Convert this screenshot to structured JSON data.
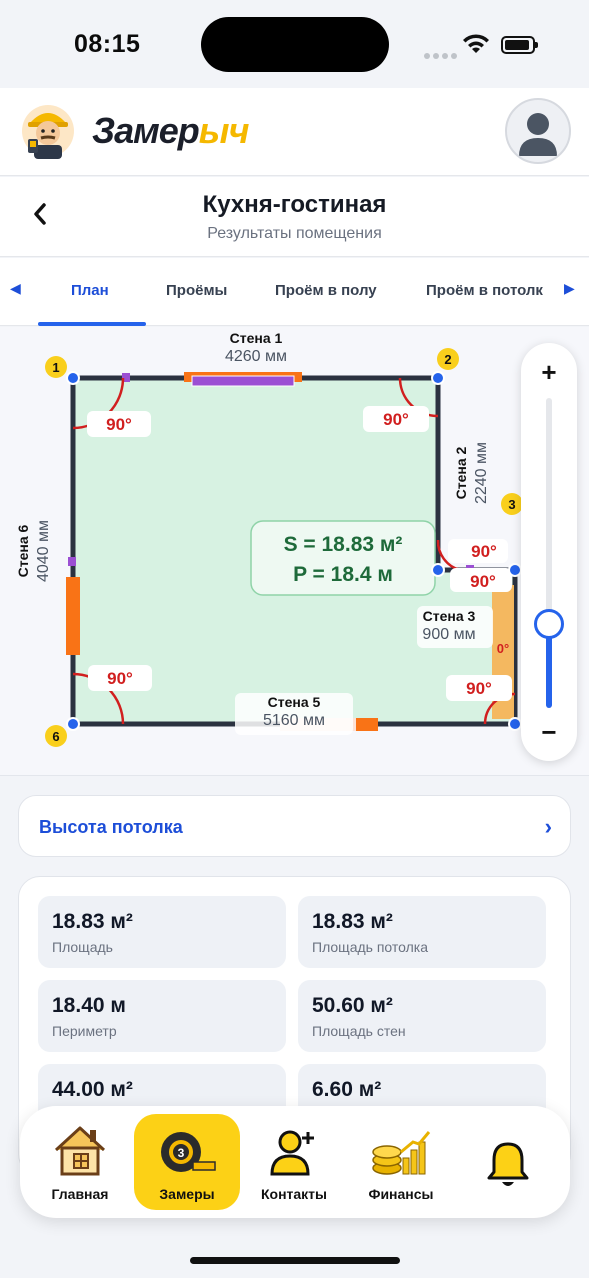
{
  "status_bar": {
    "time": "08:15"
  },
  "header": {
    "brand_part1": "Замер",
    "brand_part2": "ыч"
  },
  "title_bar": {
    "title": "Кухня-гостиная",
    "subtitle": "Результаты помещения"
  },
  "tabs": [
    {
      "label": "План",
      "active": true
    },
    {
      "label": "Проёмы",
      "active": false
    },
    {
      "label": "Проём в полу",
      "active": false
    },
    {
      "label": "Проём в потолк",
      "active": false
    }
  ],
  "plan": {
    "area_text": "S = 18.83 м²",
    "perimeter_text": "P = 18.4 м",
    "walls": [
      {
        "name": "Стена 1",
        "length": "4260 мм"
      },
      {
        "name": "Стена 2",
        "length": "2240 мм"
      },
      {
        "name": "Стена 3",
        "length": "900 мм"
      },
      {
        "name": "Стена 5",
        "length": "5160 мм"
      },
      {
        "name": "Стена 6",
        "length": "4040 мм"
      }
    ],
    "corners": [
      "1",
      "2",
      "3",
      "6"
    ],
    "angles": [
      "90°",
      "90°",
      "90°",
      "90°",
      "90°",
      "90°",
      "0°"
    ],
    "colors": {
      "floor": "#d7f2e2",
      "wall": "#2b3240",
      "door": "#f97316",
      "window": "#9b4fd3",
      "angle": "#d11f1f",
      "corner_badge": "#f9cf1c",
      "node": "#2563eb"
    }
  },
  "zoom": {
    "plus": "+",
    "minus": "−",
    "level": 0.27
  },
  "ceiling": {
    "label": "Высота потолка",
    "chevron": "›"
  },
  "stats": [
    {
      "value": "18.83 м²",
      "label": "Площадь"
    },
    {
      "value": "18.83 м²",
      "label": "Площадь потолка"
    },
    {
      "value": "18.40 м",
      "label": "Периметр"
    },
    {
      "value": "50.60 м²",
      "label": "Площадь стен"
    },
    {
      "value": "44.00 м²",
      "label": ""
    },
    {
      "value": "6.60 м²",
      "label": ""
    }
  ],
  "nav": [
    {
      "label": "Главная",
      "icon": "house-icon",
      "active": false
    },
    {
      "label": "Замеры",
      "icon": "tape-measure-icon",
      "active": true
    },
    {
      "label": "Контакты",
      "icon": "add-contact-icon",
      "active": false
    },
    {
      "label": "Финансы",
      "icon": "coins-chart-icon",
      "active": false
    },
    {
      "label": "",
      "icon": "bell-icon",
      "active": false
    }
  ]
}
